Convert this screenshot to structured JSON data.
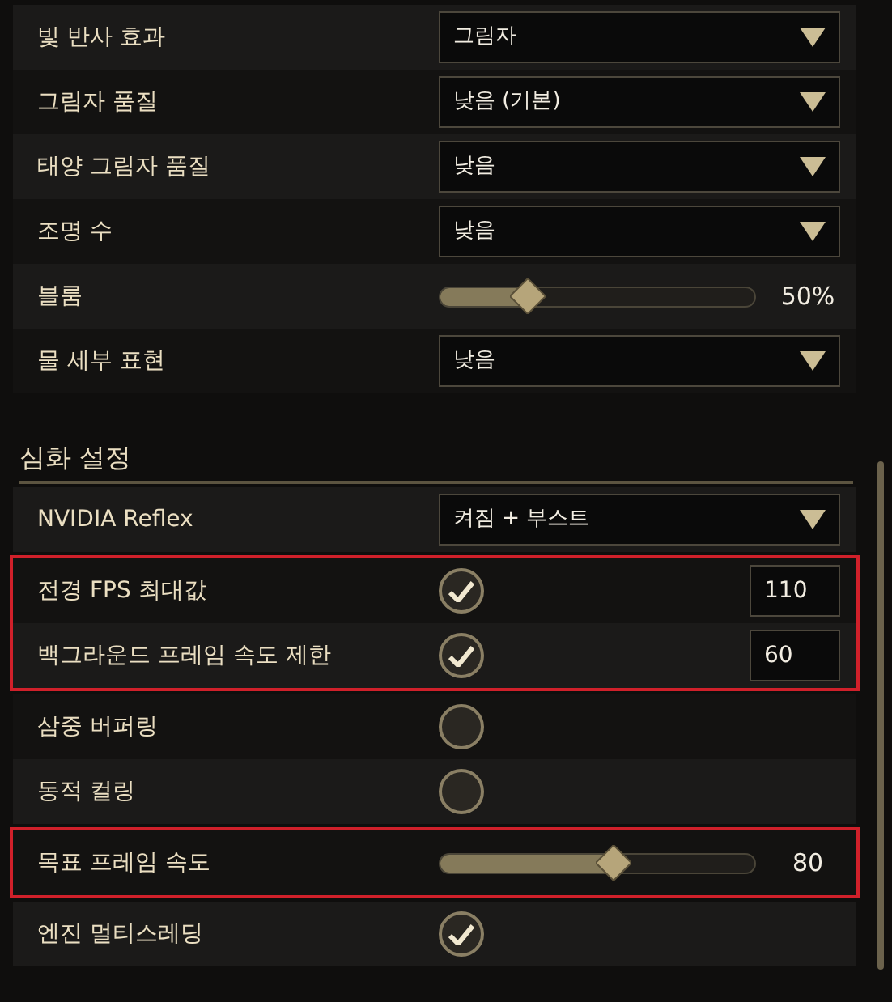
{
  "blocks": [
    {
      "highlighted": false,
      "rows": [
        {
          "kind": "dropdown",
          "label": "빛 반사 효과",
          "value": "그림자"
        },
        {
          "kind": "dropdown",
          "label": "그림자 품질",
          "value": "낮음 (기본)"
        },
        {
          "kind": "dropdown",
          "label": "태양 그림자 품질",
          "value": "낮음"
        },
        {
          "kind": "dropdown",
          "label": "조명 수",
          "value": "낮음"
        },
        {
          "kind": "slider",
          "label": "블룸",
          "level": 0.28,
          "reading": "50%"
        },
        {
          "kind": "dropdown",
          "label": "물 세부 표현",
          "value": "낮음"
        }
      ]
    },
    {
      "highlighted": false,
      "heading": "심화 설정",
      "rows": [
        {
          "kind": "dropdown",
          "label": "NVIDIA Reflex",
          "value": "켜짐 + 부스트"
        }
      ]
    },
    {
      "highlighted": true,
      "rows": [
        {
          "kind": "checkbox_number",
          "label": "전경 FPS 최대값",
          "checked": true,
          "value": "110"
        },
        {
          "kind": "checkbox_number",
          "label": "백그라운드 프레임 속도 제한",
          "checked": true,
          "value": "60"
        }
      ]
    },
    {
      "highlighted": false,
      "rows": [
        {
          "kind": "checkbox",
          "label": "삼중 버퍼링",
          "checked": false
        },
        {
          "kind": "checkbox",
          "label": "동적 컬링",
          "checked": false
        }
      ]
    },
    {
      "highlighted": true,
      "rows": [
        {
          "kind": "slider",
          "label": "목표 프레임 속도",
          "level": 0.55,
          "reading": "80"
        }
      ]
    },
    {
      "highlighted": false,
      "rows": [
        {
          "kind": "checkbox",
          "label": "엔진 멀티스레딩",
          "checked": true
        }
      ]
    }
  ]
}
